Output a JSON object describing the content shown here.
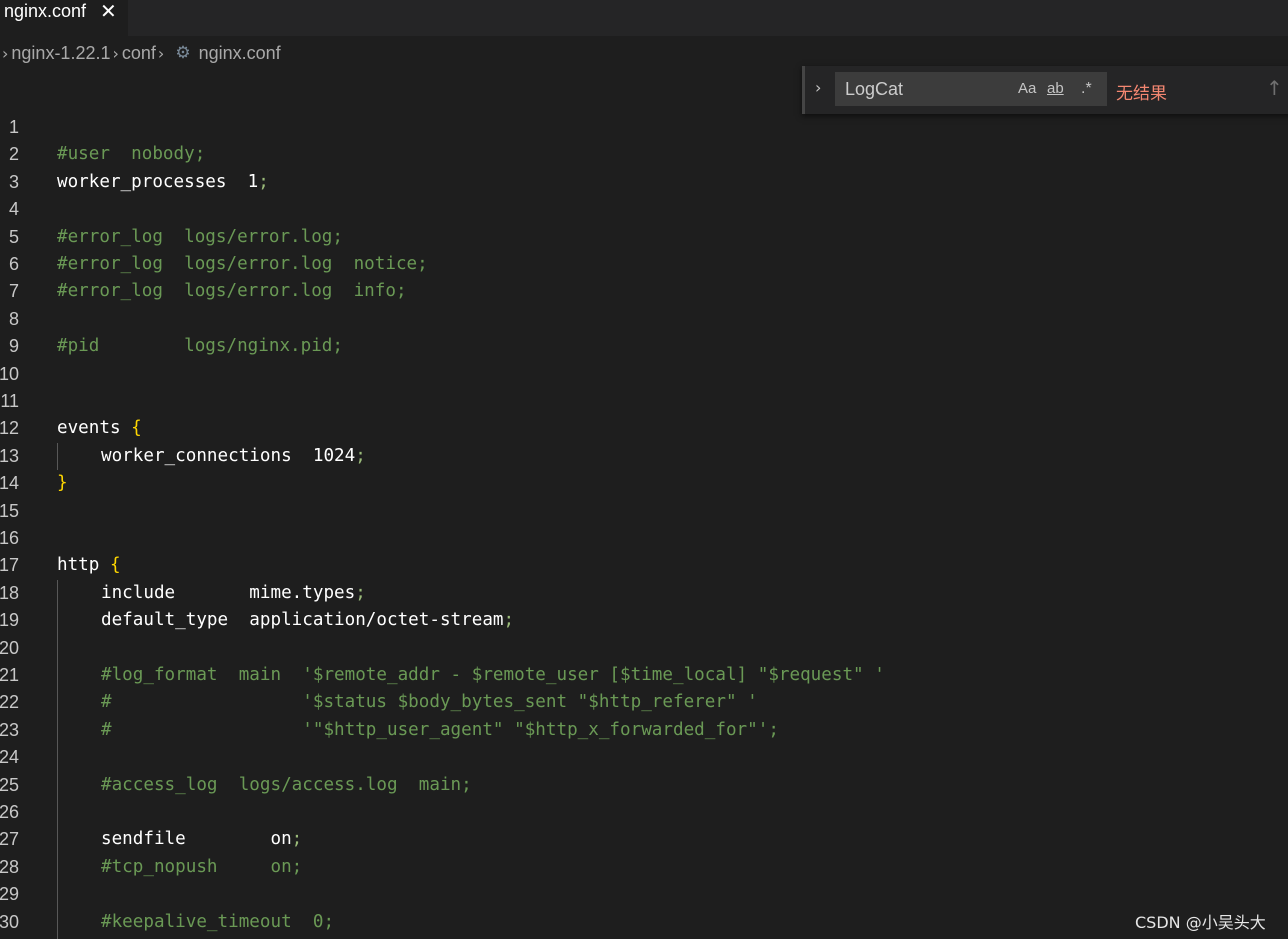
{
  "tab": {
    "label": "nginx.conf",
    "close_glyph": "✕"
  },
  "breadcrumb": {
    "items": [
      "nginx-1.22.1",
      "conf",
      "nginx.conf"
    ],
    "separator": "›"
  },
  "find": {
    "toggle_glyph": "›",
    "value": "LogCat",
    "match_case": "Aa",
    "whole_word": "ab",
    "regex": ".*",
    "status": "无结果",
    "prev_glyph": "↑"
  },
  "editor": {
    "line_numbers": [
      "1",
      "2",
      "3",
      "4",
      "5",
      "6",
      "7",
      "8",
      "9",
      "10",
      "11",
      "12",
      "13",
      "14",
      "15",
      "16",
      "17",
      "18",
      "19",
      "20",
      "21",
      "22",
      "23",
      "24",
      "25",
      "26",
      "27",
      "28",
      "29",
      "30"
    ],
    "lines": [
      {
        "indent": 0,
        "tokens": []
      },
      {
        "indent": 0,
        "tokens": [
          {
            "t": "comment",
            "v": "#user  nobody;"
          }
        ]
      },
      {
        "indent": 0,
        "tokens": [
          {
            "t": "plain",
            "v": "worker_processes  1"
          },
          {
            "t": "punct",
            "v": ";"
          }
        ]
      },
      {
        "indent": 0,
        "tokens": []
      },
      {
        "indent": 0,
        "tokens": [
          {
            "t": "comment",
            "v": "#error_log  logs/error.log;"
          }
        ]
      },
      {
        "indent": 0,
        "tokens": [
          {
            "t": "comment",
            "v": "#error_log  logs/error.log  notice;"
          }
        ]
      },
      {
        "indent": 0,
        "tokens": [
          {
            "t": "comment",
            "v": "#error_log  logs/error.log  info;"
          }
        ]
      },
      {
        "indent": 0,
        "tokens": []
      },
      {
        "indent": 0,
        "tokens": [
          {
            "t": "comment",
            "v": "#pid        logs/nginx.pid;"
          }
        ]
      },
      {
        "indent": 0,
        "tokens": []
      },
      {
        "indent": 0,
        "tokens": []
      },
      {
        "indent": 0,
        "tokens": [
          {
            "t": "plain",
            "v": "events "
          },
          {
            "t": "brace",
            "v": "{"
          }
        ]
      },
      {
        "indent": 1,
        "tokens": [
          {
            "t": "plain",
            "v": "worker_connections  1024"
          },
          {
            "t": "punct",
            "v": ";"
          }
        ]
      },
      {
        "indent": 0,
        "tokens": [
          {
            "t": "brace",
            "v": "}"
          }
        ]
      },
      {
        "indent": 0,
        "tokens": []
      },
      {
        "indent": 0,
        "tokens": []
      },
      {
        "indent": 0,
        "tokens": [
          {
            "t": "plain",
            "v": "http "
          },
          {
            "t": "brace",
            "v": "{"
          }
        ]
      },
      {
        "indent": 1,
        "tokens": [
          {
            "t": "plain",
            "v": "include       mime.types"
          },
          {
            "t": "punct",
            "v": ";"
          }
        ]
      },
      {
        "indent": 1,
        "tokens": [
          {
            "t": "plain",
            "v": "default_type  application/octet-stream"
          },
          {
            "t": "punct",
            "v": ";"
          }
        ]
      },
      {
        "indent": 1,
        "tokens": []
      },
      {
        "indent": 1,
        "tokens": [
          {
            "t": "comment",
            "v": "#log_format  main  '$remote_addr - $remote_user [$time_local] \"$request\" '"
          }
        ]
      },
      {
        "indent": 1,
        "tokens": [
          {
            "t": "comment",
            "v": "#                  '$status $body_bytes_sent \"$http_referer\" '"
          }
        ]
      },
      {
        "indent": 1,
        "tokens": [
          {
            "t": "comment",
            "v": "#                  '\"$http_user_agent\" \"$http_x_forwarded_for\"';"
          }
        ]
      },
      {
        "indent": 1,
        "tokens": []
      },
      {
        "indent": 1,
        "tokens": [
          {
            "t": "comment",
            "v": "#access_log  logs/access.log  main;"
          }
        ]
      },
      {
        "indent": 1,
        "tokens": []
      },
      {
        "indent": 1,
        "tokens": [
          {
            "t": "plain",
            "v": "sendfile        on"
          },
          {
            "t": "punct",
            "v": ";"
          }
        ]
      },
      {
        "indent": 1,
        "tokens": [
          {
            "t": "comment",
            "v": "#tcp_nopush     on;"
          }
        ]
      },
      {
        "indent": 1,
        "tokens": []
      },
      {
        "indent": 1,
        "tokens": [
          {
            "t": "comment",
            "v": "#keepalive_timeout  0;"
          }
        ]
      }
    ]
  },
  "watermark": "CSDN @小吴头大",
  "colors": {
    "background": "#1e1e1e",
    "comment": "#6a9955",
    "brace": "#ffd700",
    "find_status": "#f48771"
  }
}
